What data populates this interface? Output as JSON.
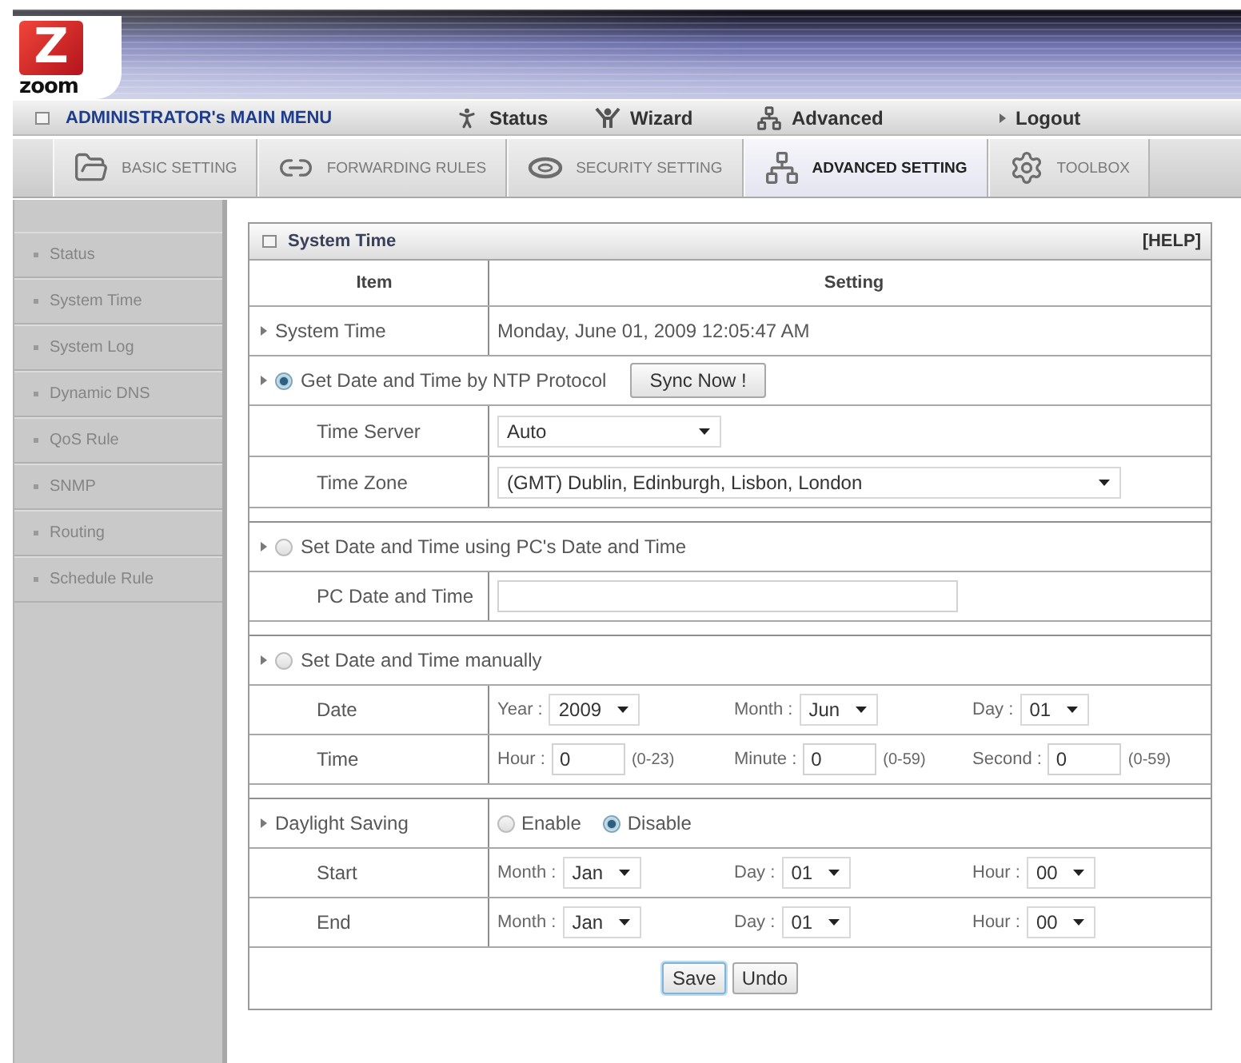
{
  "logo": {
    "mark": "Z",
    "name": "zoom"
  },
  "main_menu": {
    "title": "ADMINISTRATOR's MAIN MENU",
    "items": [
      {
        "kind": "status",
        "label": "Status"
      },
      {
        "kind": "wizard",
        "label": "Wizard"
      },
      {
        "kind": "advanced",
        "label": "Advanced"
      },
      {
        "kind": "logout",
        "label": "Logout"
      }
    ]
  },
  "tabs": [
    {
      "kind": "basic",
      "label": "BASIC SETTING",
      "selected": false
    },
    {
      "kind": "forwarding",
      "label": "FORWARDING RULES",
      "selected": false
    },
    {
      "kind": "security",
      "label": "SECURITY SETTING",
      "selected": false
    },
    {
      "kind": "advanced",
      "label": "ADVANCED SETTING",
      "selected": true
    },
    {
      "kind": "toolbox",
      "label": "TOOLBOX",
      "selected": false
    }
  ],
  "sidebar": {
    "items": [
      {
        "label": "Status"
      },
      {
        "label": "System Time"
      },
      {
        "label": "System Log"
      },
      {
        "label": "Dynamic DNS"
      },
      {
        "label": "QoS Rule"
      },
      {
        "label": "SNMP"
      },
      {
        "label": "Routing"
      },
      {
        "label": "Schedule Rule"
      }
    ]
  },
  "panel": {
    "title": "System Time",
    "help": "[HELP]",
    "columns": [
      "Item",
      "Setting"
    ],
    "sections": [
      {
        "rows": [
          {
            "kind": "info",
            "label": "System Time",
            "value": "Monday, June 01, 2009 12:05:47 AM"
          },
          {
            "kind": "option",
            "label": "Get Date and Time by NTP Protocol",
            "selected": true,
            "button": "Sync Now !"
          },
          {
            "kind": "select",
            "label": "Time Server",
            "value": "Auto"
          },
          {
            "kind": "select",
            "label": "Time Zone",
            "value": "(GMT) Dublin, Edinburgh, Lisbon, London"
          }
        ]
      },
      {
        "rows": [
          {
            "kind": "option",
            "label": "Set Date and Time using PC's Date and Time",
            "selected": false
          },
          {
            "kind": "input",
            "label": "PC Date and Time"
          }
        ]
      },
      {
        "rows": [
          {
            "kind": "option",
            "label": "Set Date and Time manually",
            "selected": false
          },
          {
            "kind": "fields",
            "label": "Date",
            "fields": [
              {
                "kind": "select",
                "label": "Year :",
                "value": "2009"
              },
              {
                "kind": "select",
                "label": "Month :",
                "value": "Jun"
              },
              {
                "kind": "select",
                "label": "Day :",
                "value": "01"
              }
            ]
          },
          {
            "kind": "fields",
            "label": "Time",
            "fields": [
              {
                "kind": "input",
                "label": "Hour :",
                "value": "0",
                "range": "(0-23)"
              },
              {
                "kind": "input",
                "label": "Minute :",
                "value": "0",
                "range": "(0-59)"
              },
              {
                "kind": "input",
                "label": "Second :",
                "value": "0",
                "range": "(0-59)"
              }
            ]
          }
        ]
      },
      {
        "rows": [
          {
            "kind": "radios",
            "label": "Daylight Saving",
            "options": [
              {
                "label": "Enable",
                "selected": false
              },
              {
                "label": "Disable",
                "selected": true
              }
            ]
          },
          {
            "kind": "fields",
            "label": "Start",
            "fields": [
              {
                "kind": "select",
                "label": "Month :",
                "value": "Jan"
              },
              {
                "kind": "select",
                "label": "Day :",
                "value": "01"
              },
              {
                "kind": "select",
                "label": "Hour :",
                "value": "00"
              }
            ]
          },
          {
            "kind": "fields",
            "label": "End",
            "fields": [
              {
                "kind": "select",
                "label": "Month :",
                "value": "Jan"
              },
              {
                "kind": "select",
                "label": "Day :",
                "value": "01"
              },
              {
                "kind": "select",
                "label": "Hour :",
                "value": "00"
              }
            ]
          }
        ]
      }
    ],
    "buttons": [
      {
        "label": "Save",
        "focused": true
      },
      {
        "label": "Undo",
        "focused": false
      }
    ]
  }
}
